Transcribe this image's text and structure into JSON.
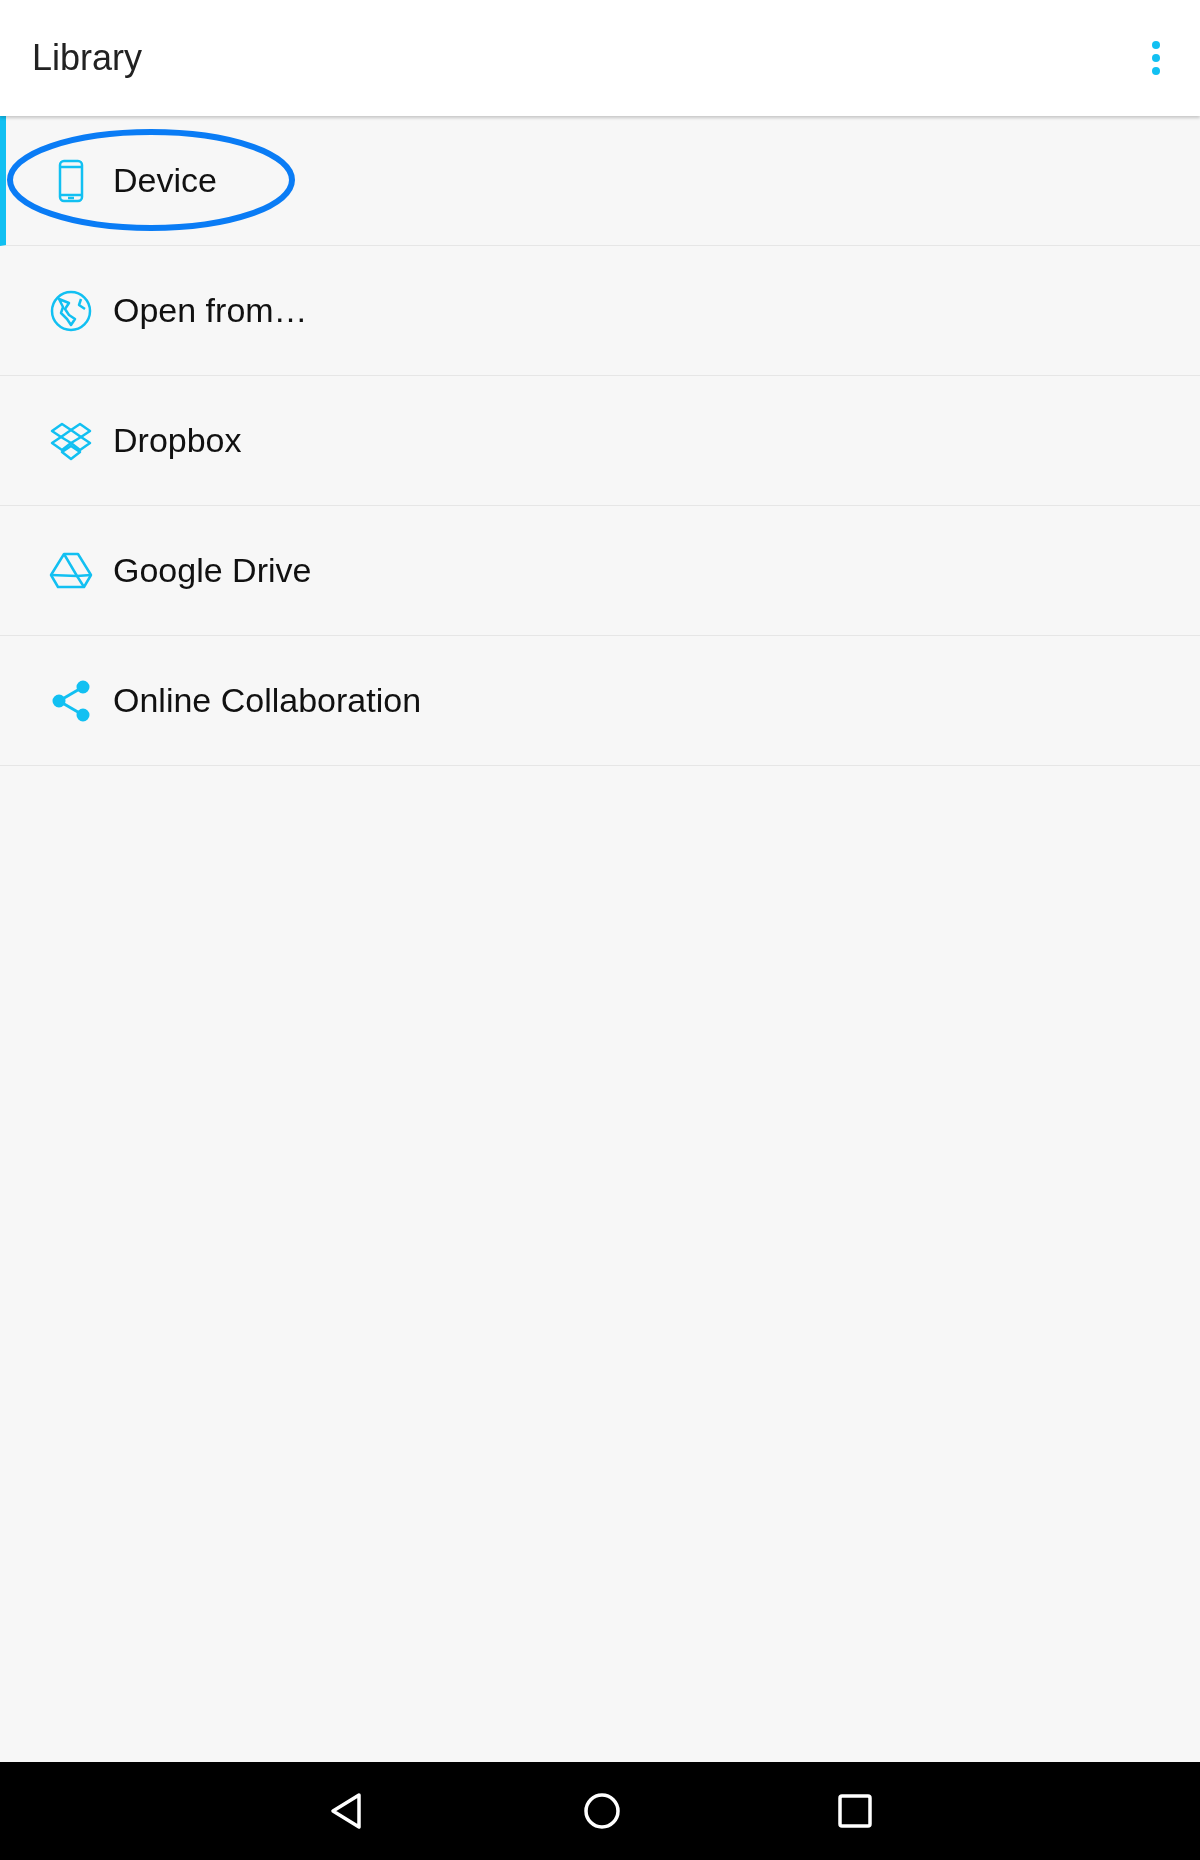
{
  "app_bar": {
    "title": "Library"
  },
  "items": [
    {
      "label": "Device",
      "kind": "device",
      "selected": true,
      "highlighted": true
    },
    {
      "label": "Open from…",
      "kind": "globe",
      "selected": false,
      "highlighted": false
    },
    {
      "label": "Dropbox",
      "kind": "dropbox",
      "selected": false,
      "highlighted": false
    },
    {
      "label": "Google Drive",
      "kind": "drive",
      "selected": false,
      "highlighted": false
    },
    {
      "label": "Online Collaboration",
      "kind": "share",
      "selected": false,
      "highlighted": false
    }
  ]
}
